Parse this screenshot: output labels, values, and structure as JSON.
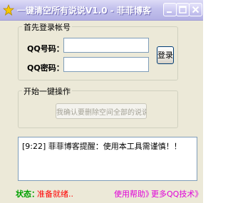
{
  "window": {
    "title": "一键清空所有说说V1.0 - 菲菲博客",
    "icon": "star-icon",
    "controls": {
      "minimize": "minimize-icon",
      "maximize": "maximize-icon",
      "close": "close-icon"
    }
  },
  "login": {
    "group_title": "首先登录帐号",
    "qq_label": "QQ号码：",
    "qq_value": "",
    "password_label": "QQ密码：",
    "password_value": "",
    "login_button": "登录"
  },
  "operation": {
    "group_title": "开始一键操作",
    "confirm_button": "我确认要删除空间全部的说说"
  },
  "log": {
    "time": "[9:22]",
    "message": "菲菲博客提醒：使用本工具需谨慎！！"
  },
  "status": {
    "label": "状态：",
    "value": "准备就绪.."
  },
  "links": {
    "help": "使用帮助》",
    "more": "更多QQ技术》"
  },
  "colors": {
    "titlebar": "#c2c0ec",
    "window_bg": "#ece9d8",
    "status_label": "#00a000",
    "status_value": "#ff0000",
    "link": "#e000d8"
  }
}
